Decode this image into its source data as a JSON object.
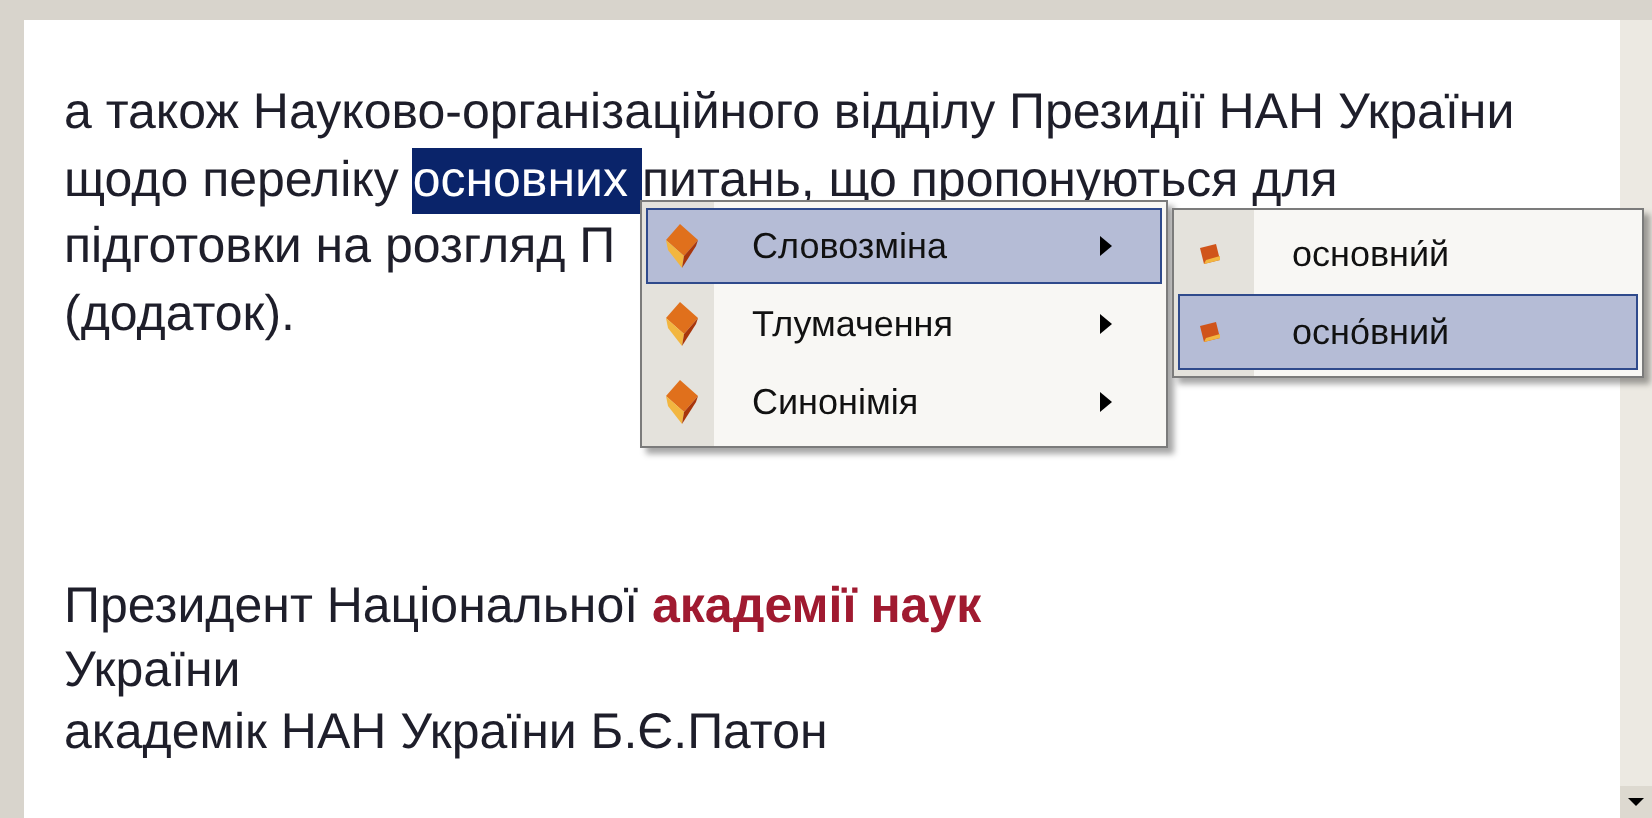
{
  "document": {
    "paragraph_lines": [
      {
        "segments": [
          {
            "kind": "text",
            "text": "а також Науково-організаційного відділу Президії НАН України"
          }
        ]
      },
      {
        "segments": [
          {
            "kind": "text",
            "text": "щодо переліку "
          },
          {
            "kind": "selection",
            "text": "основних "
          },
          {
            "kind": "text",
            "text": "питань, що пропонуються для"
          }
        ]
      },
      {
        "segments": [
          {
            "kind": "text",
            "text": "підготовки на розгляд П"
          }
        ]
      },
      {
        "segments": [
          {
            "kind": "text",
            "text": "(додаток)."
          }
        ]
      }
    ],
    "signature_lines": [
      "Президент Національної **академії наук**",
      "України",
      "академік НАН України Б.Є.Патон"
    ]
  },
  "context_menu": {
    "items": [
      {
        "label": "Словозміна",
        "selected": true,
        "submenu": true
      },
      {
        "label": "Тлумачення",
        "selected": false,
        "submenu": true
      },
      {
        "label": "Синонімія",
        "selected": false,
        "submenu": true
      }
    ]
  },
  "submenu": {
    "items": [
      {
        "label": "основни́й",
        "selected": false
      },
      {
        "label": "осно́вний",
        "selected": true
      }
    ]
  }
}
